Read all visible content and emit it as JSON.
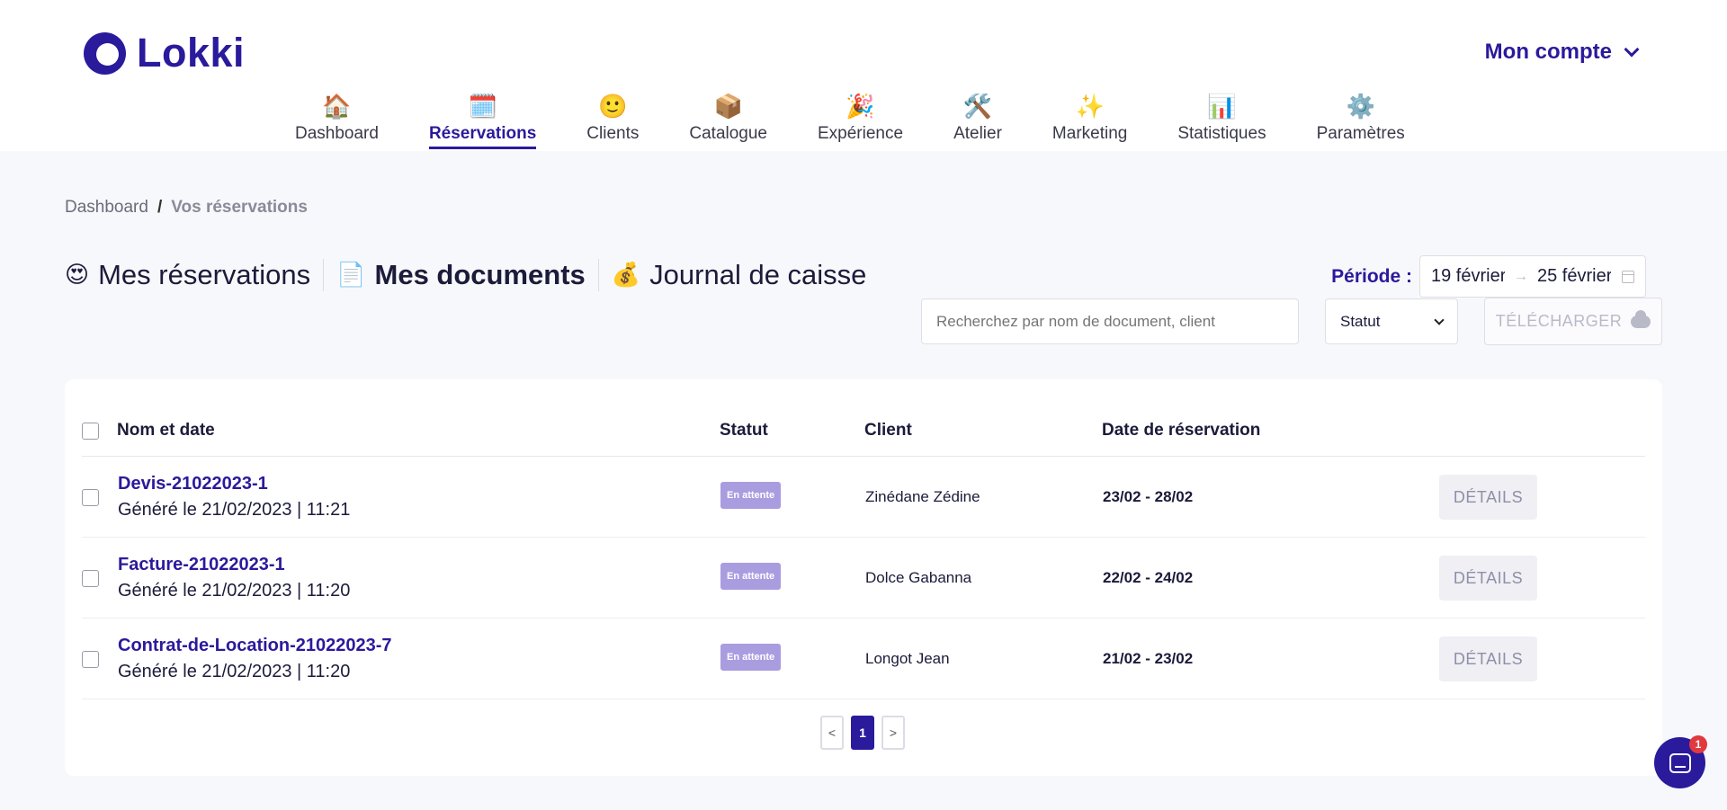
{
  "brand": {
    "name": "Lokki"
  },
  "account": {
    "label": "Mon compte"
  },
  "nav": [
    {
      "emoji": "🏠",
      "label": "Dashboard",
      "active": false
    },
    {
      "emoji": "🗓️",
      "label": "Réservations",
      "active": true
    },
    {
      "emoji": "🙂",
      "label": "Clients",
      "active": false
    },
    {
      "emoji": "📦",
      "label": "Catalogue",
      "active": false
    },
    {
      "emoji": "🎉",
      "label": "Expérience",
      "active": false
    },
    {
      "emoji": "🛠️",
      "label": "Atelier",
      "active": false
    },
    {
      "emoji": "✨",
      "label": "Marketing",
      "active": false
    },
    {
      "emoji": "📊",
      "label": "Statistiques",
      "active": false
    },
    {
      "emoji": "⚙️",
      "label": "Paramètres",
      "active": false
    }
  ],
  "breadcrumb": {
    "home": "Dashboard",
    "separator": "/",
    "current": "Vos réservations"
  },
  "tabs": [
    {
      "emoji": "😍",
      "label": "Mes réservations",
      "active": false
    },
    {
      "emoji": "📄",
      "label": "Mes documents",
      "active": true
    },
    {
      "emoji": "💰",
      "label": "Journal de caisse",
      "active": false
    }
  ],
  "period": {
    "label": "Période :",
    "start": "19 février",
    "arrow": "→",
    "end": "25 février"
  },
  "filters": {
    "search_placeholder": "Recherchez par nom de document, client",
    "status_label": "Statut",
    "download_label": "TÉLÉCHARGER"
  },
  "table": {
    "headers": {
      "name": "Nom et date",
      "status": "Statut",
      "client": "Client",
      "date": "Date de réservation"
    },
    "rows": [
      {
        "name": "Devis-21022023-1",
        "generated": "Généré le 21/02/2023 | 11:21",
        "status": "En attente",
        "client": "Zinédane Zédine",
        "dates": "23/02 - 28/02",
        "action": "DÉTAILS"
      },
      {
        "name": "Facture-21022023-1",
        "generated": "Généré le 21/02/2023 | 11:20",
        "status": "En attente",
        "client": "Dolce Gabanna",
        "dates": "22/02 - 24/02",
        "action": "DÉTAILS"
      },
      {
        "name": "Contrat-de-Location-21022023-7",
        "generated": "Généré le 21/02/2023 | 11:20",
        "status": "En attente",
        "client": "Longot Jean",
        "dates": "21/02 - 23/02",
        "action": "DÉTAILS"
      }
    ]
  },
  "pagination": {
    "prev": "<",
    "current": "1",
    "next": ">"
  },
  "chat": {
    "unread": "1"
  },
  "colors": {
    "brand": "#2a1a9c",
    "badge": "#a99de0",
    "notification": "#e0393e"
  }
}
